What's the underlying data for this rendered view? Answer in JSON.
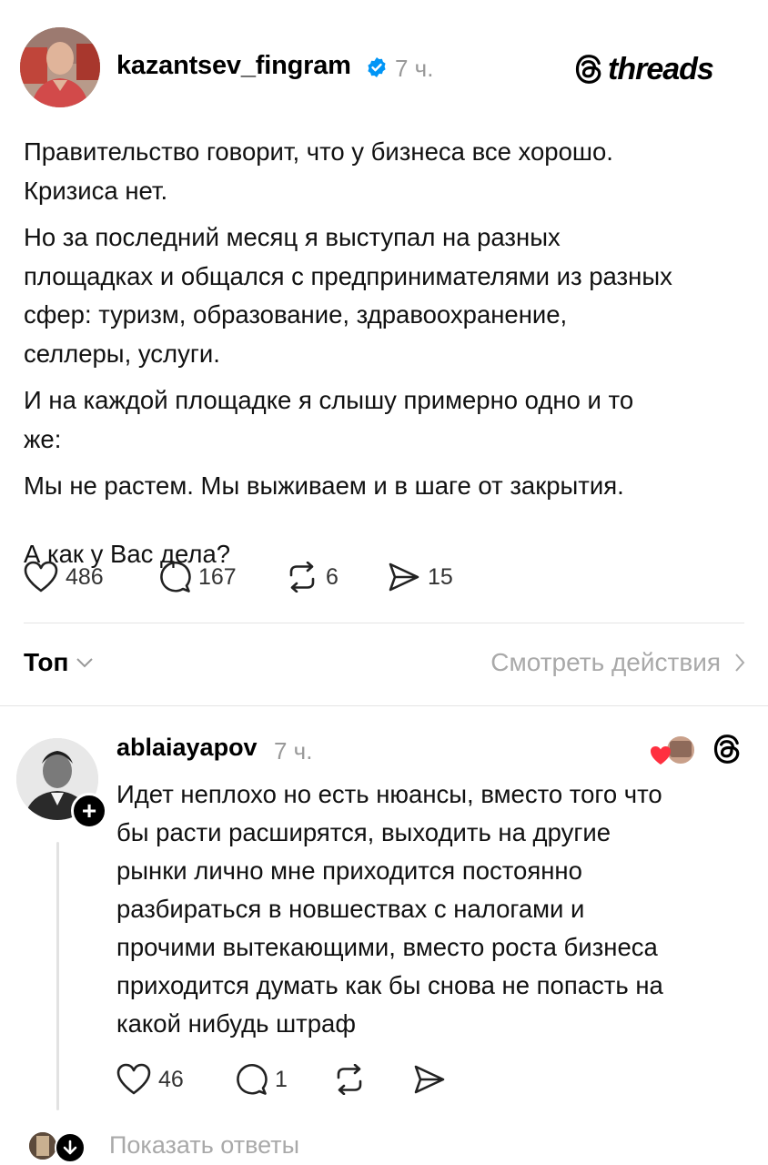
{
  "post": {
    "username": "kazantsev_fingram",
    "time": "7 ч.",
    "brand": "threads",
    "paragraphs": [
      "Правительство говорит, что у бизнеса все хорошо.",
      "Кризиса нет.",
      "Но за последний месяц я выступал на разных",
      "площадках и общался с предпринимателями из разных",
      "сфер: туризм, образование, здравоохранение,",
      "селлеры, услуги.",
      "И на каждой площадке я слышу примерно одно и то",
      "же:",
      "Мы не растем. Мы выживаем и в шаге от закрытия.",
      "А как у Вас дела?"
    ],
    "stats": {
      "likes": "486",
      "comments": "167",
      "reposts": "6",
      "shares": "15"
    }
  },
  "sort": {
    "label": "Топ",
    "view_activity": "Смотреть действия"
  },
  "reply": {
    "username": "ablaiayapov",
    "time": "7 ч.",
    "lines": [
      "Идет неплохо но есть нюансы, вместо того что",
      "бы расти расширятся, выходить на другие",
      "рынки лично мне приходится постоянно",
      "разбираться в новшествах с налогами и",
      "прочими вытекающими, вместо роста бизнеса",
      "приходится думать как бы снова не попасть на",
      "какой нибудь штраф"
    ],
    "stats": {
      "likes": "46",
      "comments": "1"
    }
  },
  "show_replies": "Показать ответы",
  "icons": [
    "verified-badge-icon",
    "threads-logo-icon",
    "heart-icon",
    "comment-icon",
    "repost-icon",
    "share-icon",
    "chevron-down-icon",
    "chevron-right-icon",
    "plus-icon",
    "arrow-down-icon"
  ],
  "colors": {
    "verified": "#0095f6",
    "like_red": "#ff3040",
    "muted": "#999999"
  }
}
